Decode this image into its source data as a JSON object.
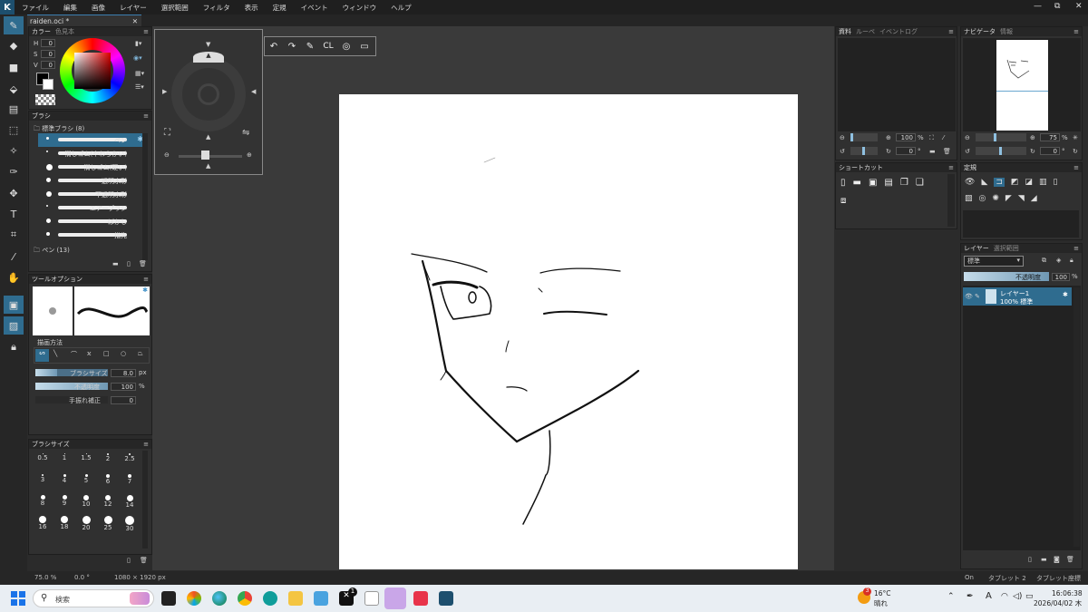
{
  "menubar": {
    "logo": "K",
    "items": [
      "ファイル",
      "編集",
      "画像",
      "レイヤー",
      "選択範囲",
      "フィルタ",
      "表示",
      "定規",
      "イベント",
      "ウィンドウ",
      "ヘルプ"
    ],
    "win_min": "—",
    "win_restore": "⧉",
    "win_close": "✕"
  },
  "tab": {
    "title": "raiden.oci *",
    "close": "✕"
  },
  "color_panel": {
    "tab1": "カラー",
    "tab2": "色見本",
    "h_label": "H",
    "h_value": "0",
    "s_label": "S",
    "s_value": "0",
    "v_label": "V",
    "v_value": "0"
  },
  "brush_panel": {
    "title": "ブラシ",
    "group1": "標準ブラシ (8)",
    "brushes": [
      "ペン",
      "消しゴム(やわらかい)",
      "消しゴム(硬い)",
      "透明水彩",
      "不透明水彩",
      "エアーブラシ",
      "ぼかし",
      "指先"
    ],
    "group2": "ペン (13)"
  },
  "tool_options": {
    "title": "ツールオプション",
    "draw_method": "描画方法",
    "brush_size_label": "ブラシサイズ",
    "brush_size_value": "8.0",
    "brush_size_unit": "px",
    "opacity_label": "不透明度",
    "opacity_value": "100",
    "opacity_unit": "%",
    "stabilizer_label": "手振れ補正",
    "stabilizer_value": "0"
  },
  "brush_size_panel": {
    "title": "ブラシサイズ",
    "sizes": [
      "0.5",
      "1",
      "1.5",
      "2",
      "2.5",
      "3",
      "4",
      "5",
      "6",
      "7",
      "8",
      "9",
      "10",
      "12",
      "14",
      "16",
      "18",
      "20",
      "25",
      "30"
    ]
  },
  "quick_toolbar": {
    "undo": "↶",
    "redo": "↷",
    "brush": "✎",
    "cl": "CL",
    "target": "◎",
    "window": "▭"
  },
  "material_panel": {
    "tab1": "資料",
    "tab2": "ルーペ",
    "tab3": "イベントログ",
    "zoom_value": "100",
    "zoom_unit": "%",
    "rotate_value": "0",
    "rotate_unit": "°"
  },
  "shortcut_panel": {
    "title": "ショートカット"
  },
  "navigator_panel": {
    "tab1": "ナビゲータ",
    "tab2": "情報",
    "zoom_value": "75",
    "zoom_unit": "%",
    "rotate_value": "0",
    "rotate_unit": "°"
  },
  "ruler_panel": {
    "title": "定規"
  },
  "layer_panel": {
    "tab1": "レイヤー",
    "tab2": "選択範囲",
    "blend_mode": "標準",
    "opacity_label": "不透明度",
    "opacity_value": "100",
    "opacity_unit": "%",
    "layer_name": "レイヤー1",
    "layer_info": "100% 標準"
  },
  "statusbar": {
    "zoom": "75.0 %",
    "rotation": "0.0 °",
    "size": "1080 × 1920 px",
    "on": "On",
    "tablet": "タブレット 2",
    "tablet_coord": "タブレット座標"
  },
  "taskbar": {
    "search_placeholder": "検索",
    "weather_temp": "16°C",
    "weather_text": "晴れ",
    "weather_badge": "3",
    "time": "16:06:38",
    "date": "2026/04/02 木",
    "ime": "A",
    "x_badge": "1"
  },
  "colors": {
    "accent": "#2f6c8f",
    "panel": "#303030",
    "canvas_bg": "#3a3a3a"
  }
}
